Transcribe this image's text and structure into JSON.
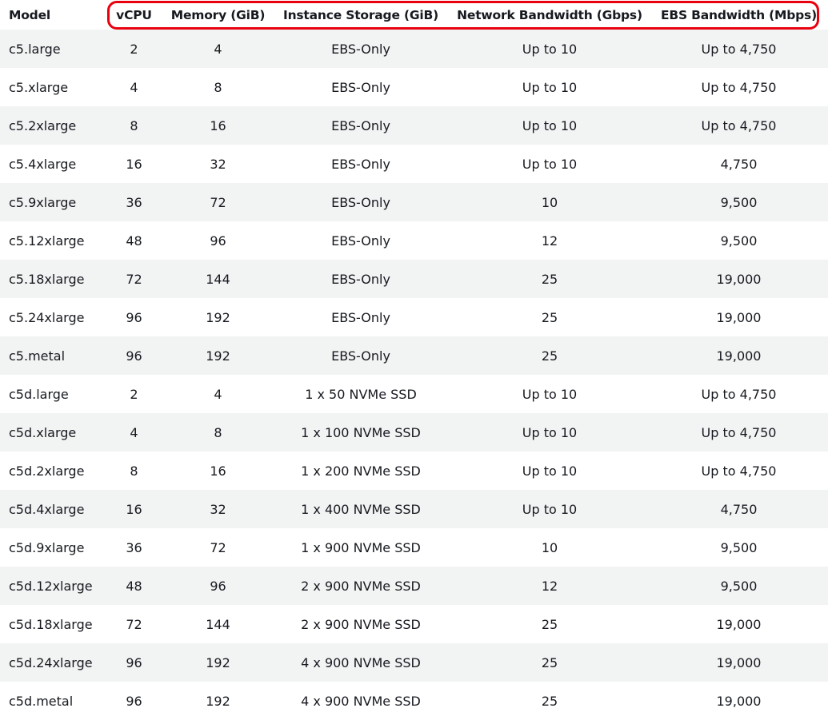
{
  "table": {
    "headers": {
      "model": "Model",
      "vcpu": "vCPU",
      "memory": "Memory (GiB)",
      "storage": "Instance Storage (GiB)",
      "network": "Network Bandwidth (Gbps)",
      "ebs": "EBS Bandwidth (Mbps)"
    },
    "rows": [
      {
        "model": "c5.large",
        "vcpu": "2",
        "memory": "4",
        "storage": "EBS-Only",
        "network": "Up to 10",
        "ebs": "Up to 4,750"
      },
      {
        "model": "c5.xlarge",
        "vcpu": "4",
        "memory": "8",
        "storage": "EBS-Only",
        "network": "Up to 10",
        "ebs": "Up to 4,750"
      },
      {
        "model": "c5.2xlarge",
        "vcpu": "8",
        "memory": "16",
        "storage": "EBS-Only",
        "network": "Up to 10",
        "ebs": "Up to 4,750"
      },
      {
        "model": "c5.4xlarge",
        "vcpu": "16",
        "memory": "32",
        "storage": "EBS-Only",
        "network": "Up to 10",
        "ebs": "4,750"
      },
      {
        "model": "c5.9xlarge",
        "vcpu": "36",
        "memory": "72",
        "storage": "EBS-Only",
        "network": "10",
        "ebs": "9,500"
      },
      {
        "model": "c5.12xlarge",
        "vcpu": "48",
        "memory": "96",
        "storage": "EBS-Only",
        "network": "12",
        "ebs": "9,500"
      },
      {
        "model": "c5.18xlarge",
        "vcpu": "72",
        "memory": "144",
        "storage": "EBS-Only",
        "network": "25",
        "ebs": "19,000"
      },
      {
        "model": "c5.24xlarge",
        "vcpu": "96",
        "memory": "192",
        "storage": "EBS-Only",
        "network": "25",
        "ebs": "19,000"
      },
      {
        "model": "c5.metal",
        "vcpu": "96",
        "memory": "192",
        "storage": "EBS-Only",
        "network": "25",
        "ebs": "19,000"
      },
      {
        "model": "c5d.large",
        "vcpu": "2",
        "memory": "4",
        "storage": "1 x 50 NVMe SSD",
        "network": "Up to 10",
        "ebs": "Up to 4,750"
      },
      {
        "model": "c5d.xlarge",
        "vcpu": "4",
        "memory": "8",
        "storage": "1 x 100 NVMe SSD",
        "network": "Up to 10",
        "ebs": "Up to 4,750"
      },
      {
        "model": "c5d.2xlarge",
        "vcpu": "8",
        "memory": "16",
        "storage": "1 x 200 NVMe SSD",
        "network": "Up to 10",
        "ebs": "Up to 4,750"
      },
      {
        "model": "c5d.4xlarge",
        "vcpu": "16",
        "memory": "32",
        "storage": "1 x 400 NVMe SSD",
        "network": "Up to 10",
        "ebs": "4,750"
      },
      {
        "model": "c5d.9xlarge",
        "vcpu": "36",
        "memory": "72",
        "storage": "1 x 900 NVMe SSD",
        "network": "10",
        "ebs": "9,500"
      },
      {
        "model": "c5d.12xlarge",
        "vcpu": "48",
        "memory": "96",
        "storage": "2 x 900 NVMe SSD",
        "network": "12",
        "ebs": "9,500"
      },
      {
        "model": "c5d.18xlarge",
        "vcpu": "72",
        "memory": "144",
        "storage": "2 x 900 NVMe SSD",
        "network": "25",
        "ebs": "19,000"
      },
      {
        "model": "c5d.24xlarge",
        "vcpu": "96",
        "memory": "192",
        "storage": "4 x 900 NVMe SSD",
        "network": "25",
        "ebs": "19,000"
      },
      {
        "model": "c5d.metal",
        "vcpu": "96",
        "memory": "192",
        "storage": "4 x 900 NVMe SSD",
        "network": "25",
        "ebs": "19,000"
      }
    ]
  },
  "colors": {
    "highlight_border": "#e8000f",
    "stripe_row": "#f2f3f3",
    "text": "#16191f"
  }
}
